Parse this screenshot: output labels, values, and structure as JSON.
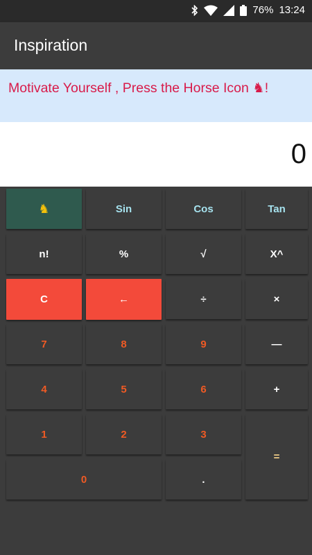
{
  "status_bar": {
    "battery": "76%",
    "time": "13:24"
  },
  "app_bar": {
    "title": "Inspiration"
  },
  "banner": {
    "text": "Motivate Yourself , Press the Horse Icon ♞!"
  },
  "display": {
    "value": "0"
  },
  "keys": {
    "horse": "♞",
    "sin": "Sin",
    "cos": "Cos",
    "tan": "Tan",
    "factorial": "n!",
    "percent": "%",
    "sqrt": "√",
    "power": "X^",
    "clear": "C",
    "backspace": "←",
    "divide": "÷",
    "multiply": "×",
    "seven": "7",
    "eight": "8",
    "nine": "9",
    "minus": "—",
    "four": "4",
    "five": "5",
    "six": "6",
    "plus": "+",
    "one": "1",
    "two": "2",
    "three": "3",
    "equals": "=",
    "zero": "0",
    "dot": "."
  }
}
